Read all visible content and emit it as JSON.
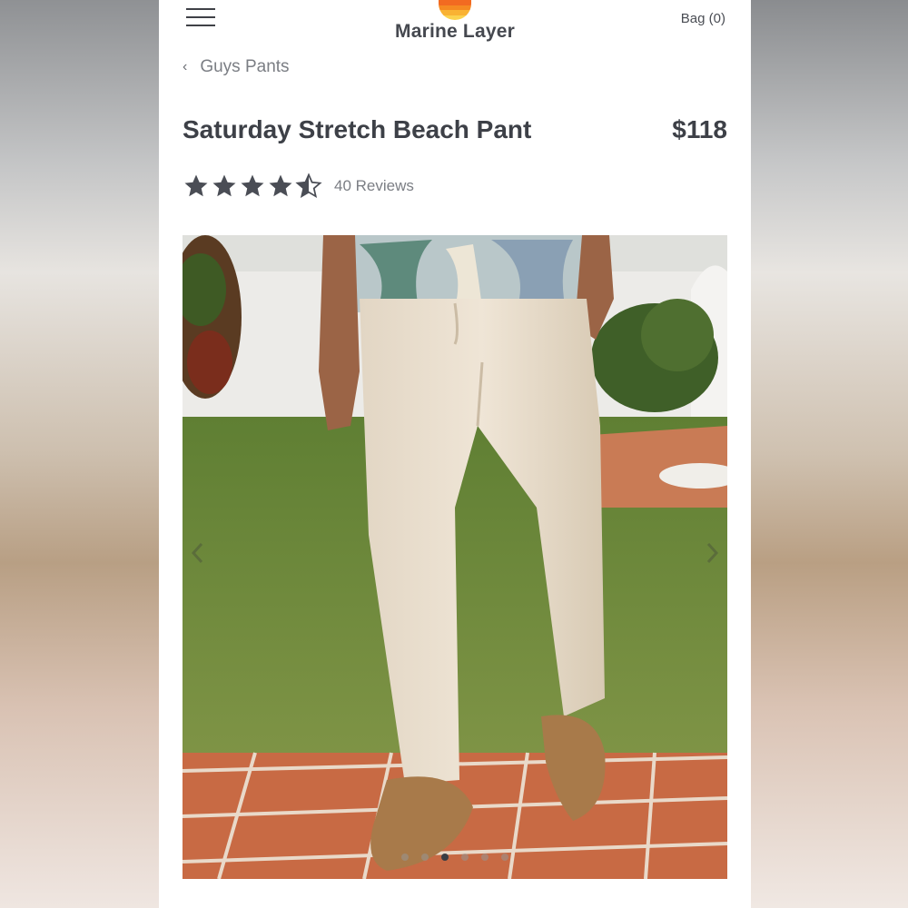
{
  "header": {
    "brand": "Marine Layer",
    "bag_label": "Bag (0)",
    "menu_icon": "hamburger-menu-icon",
    "logo_colors": [
      "#f26a21",
      "#f58a22",
      "#f9b233",
      "#fbd24e"
    ]
  },
  "breadcrumb": {
    "label": "Guys Pants",
    "icon": "chevron-left-icon"
  },
  "product": {
    "title": "Saturday Stretch Beach Pant",
    "price": "$118",
    "rating": 4.5,
    "rating_max": 5,
    "reviews_label": "40 Reviews"
  },
  "carousel": {
    "total_slides": 6,
    "active_index": 2
  },
  "colors": {
    "text_dark": "#3d4047",
    "text_muted": "#7b7e84",
    "star": "#4a4d55"
  }
}
